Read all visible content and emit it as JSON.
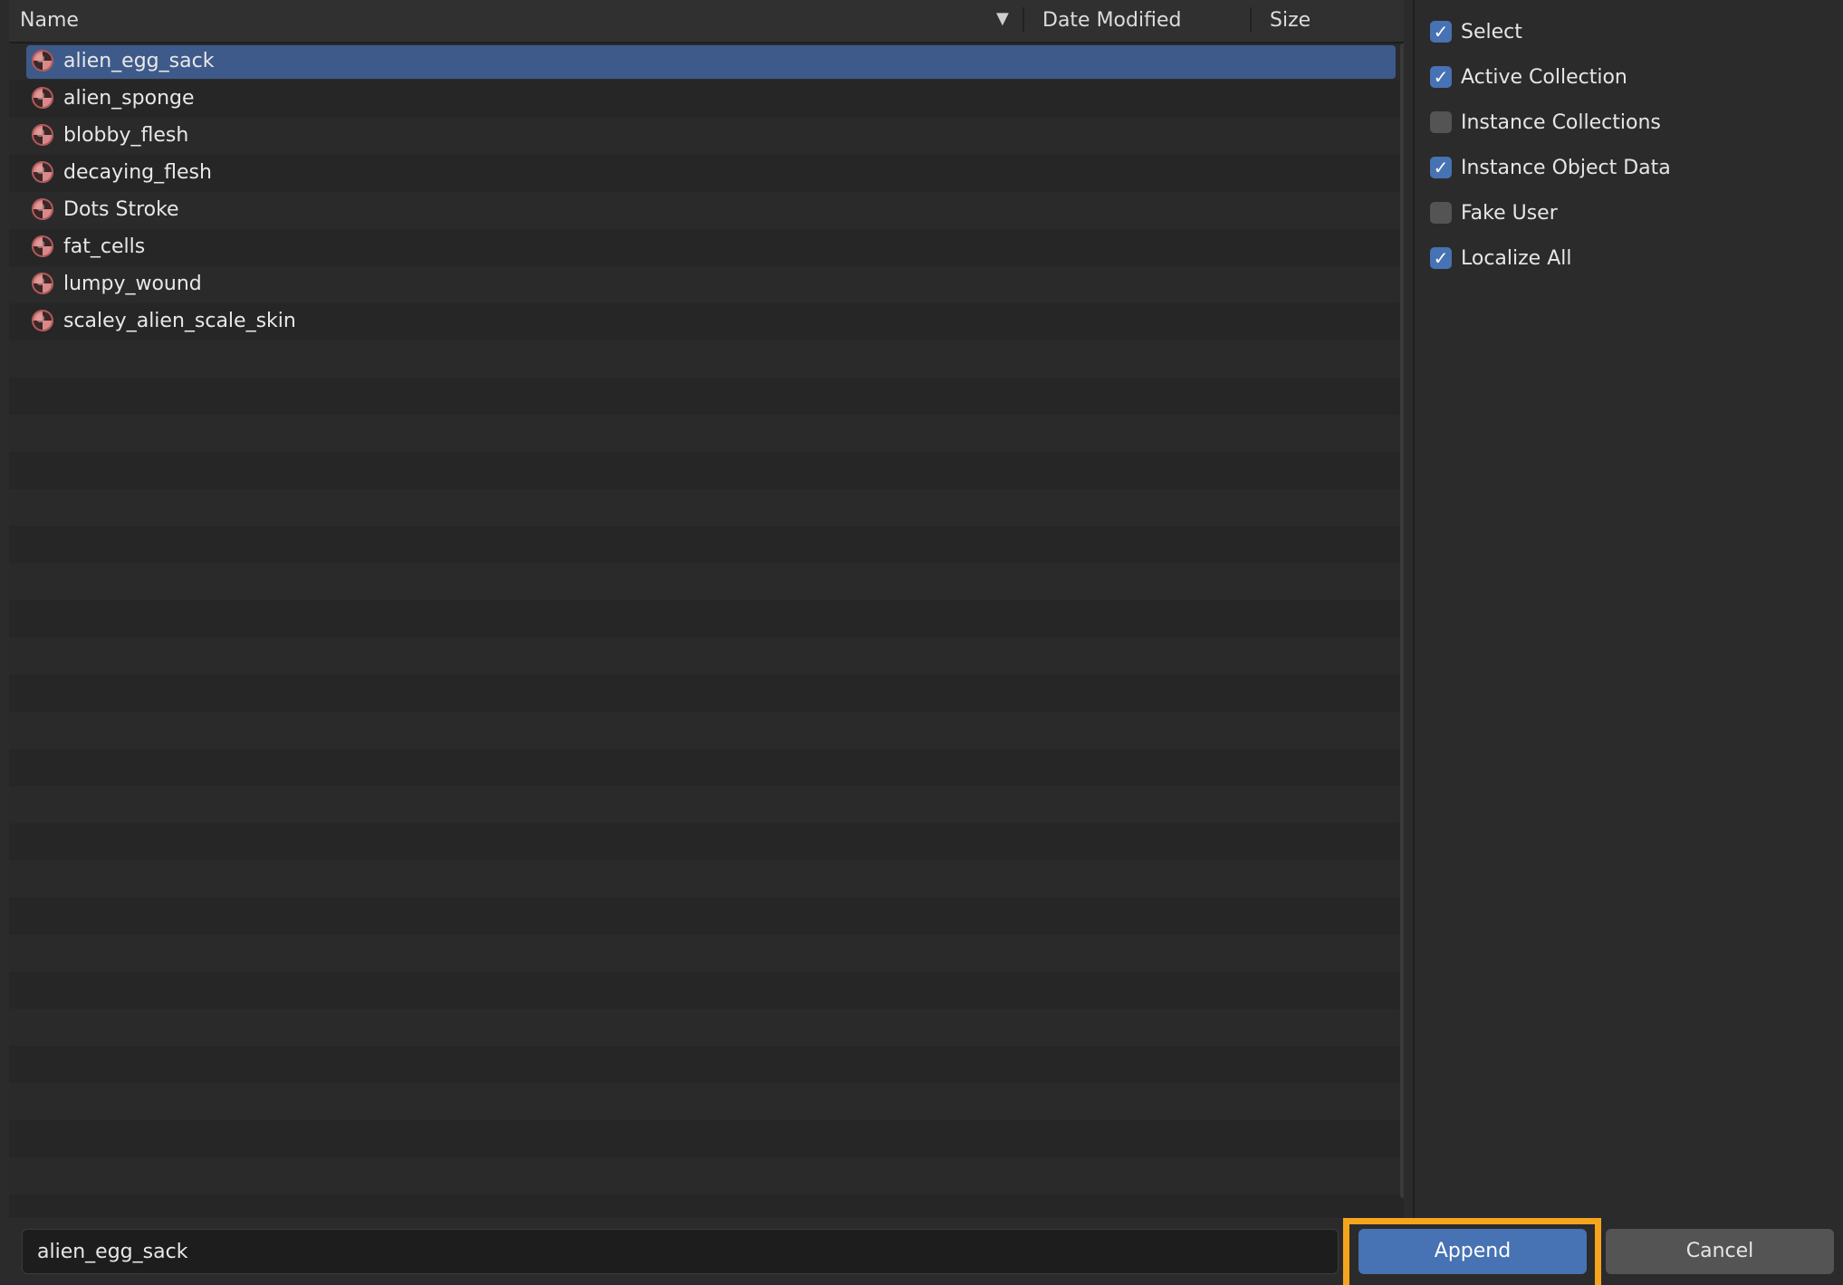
{
  "columns": {
    "name": "Name",
    "date_modified": "Date Modified",
    "size": "Size",
    "sort_icon": "sort-descending-icon"
  },
  "files": [
    {
      "name": "alien_egg_sack",
      "icon": "material-icon",
      "selected": true
    },
    {
      "name": "alien_sponge",
      "icon": "material-icon",
      "selected": false
    },
    {
      "name": "blobby_flesh",
      "icon": "material-icon",
      "selected": false
    },
    {
      "name": "decaying_flesh",
      "icon": "material-icon",
      "selected": false
    },
    {
      "name": "Dots Stroke",
      "icon": "material-icon",
      "selected": false
    },
    {
      "name": "fat_cells",
      "icon": "material-icon",
      "selected": false
    },
    {
      "name": "lumpy_wound",
      "icon": "material-icon",
      "selected": false
    },
    {
      "name": "scaley_alien_scale_skin",
      "icon": "material-icon",
      "selected": false
    }
  ],
  "options": [
    {
      "label": "Select",
      "checked": true
    },
    {
      "label": "Active Collection",
      "checked": true
    },
    {
      "label": "Instance Collections",
      "checked": false
    },
    {
      "label": "Instance Object Data",
      "checked": true
    },
    {
      "label": "Fake User",
      "checked": false
    },
    {
      "label": "Localize All",
      "checked": true
    }
  ],
  "bottom": {
    "filename_value": "alien_egg_sack",
    "append_label": "Append",
    "cancel_label": "Cancel"
  },
  "colors": {
    "accent": "#4772b3",
    "selection": "#3e5a8a",
    "focus": "#f5a41e",
    "material_icon": "#d98989"
  }
}
